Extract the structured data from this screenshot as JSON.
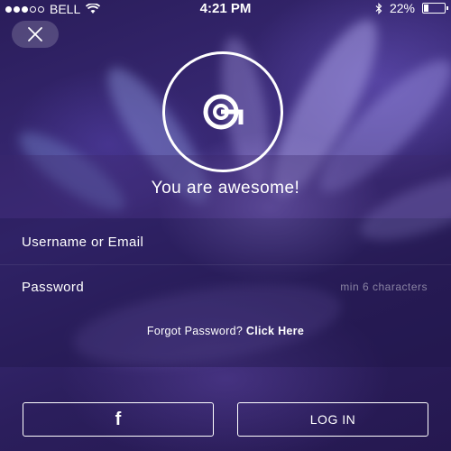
{
  "status_bar": {
    "carrier": "BELL",
    "time": "4:21 PM",
    "battery": "22%",
    "battery_level": 0.22,
    "signal_bars_filled": 3,
    "signal_bars_total": 5
  },
  "close_button": {
    "icon": "close-icon"
  },
  "logo": {
    "icon": "q-logo-icon"
  },
  "title": "You are awesome!",
  "form": {
    "username_placeholder": "Username or Email",
    "password_placeholder": "Password",
    "password_hint": "min 6 characters",
    "forgot_text": "Forgot Password?",
    "forgot_link": "Click Here"
  },
  "buttons": {
    "facebook_icon": "facebook-icon",
    "facebook_glyph": "f",
    "login_label": "LOG IN"
  },
  "colors": {
    "text": "#ffffff",
    "background": "#2c1f55"
  }
}
